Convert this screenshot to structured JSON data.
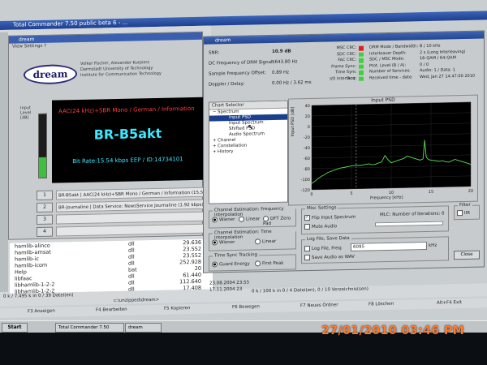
{
  "total_commander": {
    "title": "Total Commander 7.50 public beta 6 - ...",
    "files": [
      {
        "name": "hamlib-alinco",
        "ext": "dll",
        "size": "29.636"
      },
      {
        "name": "hamlib-amsat",
        "ext": "dll",
        "size": "23.552"
      },
      {
        "name": "hamlib-ic",
        "ext": "dll",
        "size": "23.552"
      },
      {
        "name": "hamlib-icom",
        "ext": "dll",
        "size": "252.928"
      },
      {
        "name": "Help",
        "ext": "bat",
        "size": "20"
      },
      {
        "name": "libfaac",
        "ext": "dll",
        "size": "61.440"
      },
      {
        "name": "libhamlib-1-2-2",
        "ext": "dll",
        "size": "112.640"
      },
      {
        "name": "libhamlib-1-2-2",
        "ext": "dll",
        "size": "17.408"
      }
    ],
    "status_left": "0 k / 7.495 k in 0 / 39 Datei(en)",
    "status_right": "0 k / 100 k in 0 / 4 Datei(en), 0 / 10 Verzeichnis(sen)",
    "path": "c:\\unzipped\\dream>",
    "dates": [
      "23.08.2004 23:55",
      "17.11.2004 23"
    ],
    "fkeys": [
      "F3 Anzeigen",
      "F4 Bearbeiten",
      "F5 Kopieren",
      "F6 Bewegen",
      "F7 Neues Ordner",
      "F8 Löschen",
      "Alt+F4 Exit"
    ]
  },
  "dream_main": {
    "title": "dream",
    "menu": "View  Settings  ?",
    "logo": "dream",
    "credits": [
      "Volker Fischer, Alexander Kurpiers",
      "Darmstadt University of Technology",
      "Institute for Communication Technology"
    ],
    "level_label": "Input Level [dB]",
    "level": 0.32,
    "audio_label": "AAC(24 kHz)+SBR Mono / German / Information",
    "station": "BR-B5akt",
    "bitrate": "Bit Rate:15.54 kbps EEP / ID:14734101",
    "services": [
      {
        "num": "1",
        "text": "BR-B5akt | AAC(24 kHz)+SBR Mono / German / Information (15.54 kbps)"
      },
      {
        "num": "2",
        "text": "BR-Journaline | Data Service: NewsService Journaline (1.92 kbps)"
      },
      {
        "num": "3",
        "text": ""
      },
      {
        "num": "4",
        "text": ""
      }
    ]
  },
  "dream_eval": {
    "title": "dream",
    "info_left": [
      {
        "label": "SNR:",
        "value": "10.9 dB"
      },
      {
        "label": "DC Frequency of DRM Signal:",
        "value": "5643.80 Hz"
      },
      {
        "label": "Sample Frequency Offset:",
        "value": "0.89 Hz"
      },
      {
        "label": "Doppler / Delay:",
        "value": "0.00 Hz / 3.62 ms"
      }
    ],
    "leds": [
      {
        "label": "MSC CRC:",
        "color": "#e02020"
      },
      {
        "label": "SDC CRC:",
        "color": "#3fcf3f"
      },
      {
        "label": "FAC CRC:",
        "color": "#3fcf3f"
      },
      {
        "label": "Frame Sync:",
        "color": "#3fcf3f"
      },
      {
        "label": "Time Sync Acq:",
        "color": "#3fcf3f"
      },
      {
        "label": "I/O Interface:",
        "color": "#3fcf3f"
      }
    ],
    "info_right": [
      {
        "label": "DRM Mode / Bandwidth:",
        "value": "B / 10 kHz"
      },
      {
        "label": "Interleaver Depth:",
        "value": "2 s (Long Interleaving)"
      },
      {
        "label": "SDC / MSC Mode:",
        "value": "16-QAM / 64-QAM"
      },
      {
        "label": "Prot. Level (B / A):",
        "value": "0 / 0"
      },
      {
        "label": "Number of Services:",
        "value": "Audio: 1 / Data: 1"
      },
      {
        "label": "Received time - date:",
        "value": "Wed, Jan 27 14:47:00 2010"
      }
    ],
    "chart_selector": {
      "header": "Chart Selector",
      "items": [
        {
          "label": "Spectrum",
          "selected": false,
          "level": 0,
          "expander": "−"
        },
        {
          "label": "Input PSD",
          "selected": true,
          "level": 1,
          "expander": ""
        },
        {
          "label": "Input Spectrum",
          "selected": false,
          "level": 1,
          "expander": ""
        },
        {
          "label": "Shifted PSD",
          "selected": false,
          "level": 1,
          "expander": ""
        },
        {
          "label": "Audio Spectrum",
          "selected": false,
          "level": 1,
          "expander": ""
        },
        {
          "label": "Channel",
          "selected": false,
          "level": 0,
          "expander": "+"
        },
        {
          "label": "Constellation",
          "selected": false,
          "level": 0,
          "expander": "+"
        },
        {
          "label": "History",
          "selected": false,
          "level": 0,
          "expander": "+"
        }
      ]
    },
    "freq_interp": {
      "title": "Channel Estimation: Frequency Interpolation",
      "options": [
        {
          "label": "Wiener",
          "on": true
        },
        {
          "label": "Linear",
          "on": false
        },
        {
          "label": "DFT Zero Pad",
          "on": false
        }
      ]
    },
    "time_interp": {
      "title": "Channel Estimation: Time Interpolation",
      "options": [
        {
          "label": "Wiener",
          "on": true
        },
        {
          "label": "Linear",
          "on": false
        }
      ]
    },
    "time_sync": {
      "title": "Time Sync Tracking",
      "options": [
        {
          "label": "Guard Energy",
          "on": true
        },
        {
          "label": "First Peak",
          "on": false
        }
      ]
    },
    "misc": {
      "title": "Misc Settings",
      "flip": "Flip Input Spectrum",
      "mute": "Mute Audio",
      "mlc": "MLC: Number of Iterations: 0"
    },
    "filter": {
      "title": "Filter",
      "option": "IIR"
    },
    "log": {
      "title": "Log File, Save Data",
      "log_label": "Log File, Freq:",
      "freq": "6095",
      "unit": "kHz",
      "save_audio": "Save Audio as WAV"
    },
    "close": "Close"
  },
  "chart_data": {
    "type": "line",
    "title": "Input PSD",
    "xlabel": "Frequency [kHz]",
    "ylabel": "Input PSD [dB]",
    "xlim": [
      0,
      20
    ],
    "ylim": [
      -120,
      40
    ],
    "yticks": [
      40,
      20,
      0,
      -20,
      -40,
      -60,
      -80,
      -100,
      -120
    ],
    "xticks": [
      0,
      5,
      10,
      15,
      20
    ],
    "marker_x": 5.6,
    "series": [
      {
        "color": "#58e050",
        "x": [
          0,
          0.4,
          0.8,
          1.2,
          1.6,
          2,
          2.4,
          2.8,
          3.2,
          3.6,
          4,
          4.4,
          4.8,
          5.2,
          5.6,
          6,
          6.4,
          6.8,
          7.2,
          7.6,
          8,
          8.4,
          8.8,
          9.2,
          9.6,
          10,
          10.4,
          10.8,
          11.2,
          11.6,
          12,
          12.4,
          12.8,
          13.2,
          13.6,
          14,
          14.2,
          14.4,
          14.6,
          14.8,
          15.2,
          15.6,
          16,
          16.4,
          16.8,
          17.2,
          17.6,
          18,
          18.4,
          18.8,
          19.2,
          19.6,
          20
        ],
        "y": [
          -108,
          -104,
          -99,
          -95,
          -92,
          -88,
          -86,
          -84,
          -82,
          -80,
          -79,
          -78,
          -77,
          -76,
          -75,
          -76,
          -75,
          -74,
          -73,
          -75,
          -74,
          -72,
          -70,
          -58,
          -66,
          -72,
          -70,
          -68,
          -66,
          -64,
          -60,
          -62,
          -64,
          -66,
          -68,
          -66,
          -30,
          -62,
          -66,
          -68,
          -69,
          -70,
          -71,
          -70,
          -72,
          -73,
          -71,
          -68,
          -70,
          -72,
          -74,
          -76,
          -78
        ]
      }
    ]
  }
}
